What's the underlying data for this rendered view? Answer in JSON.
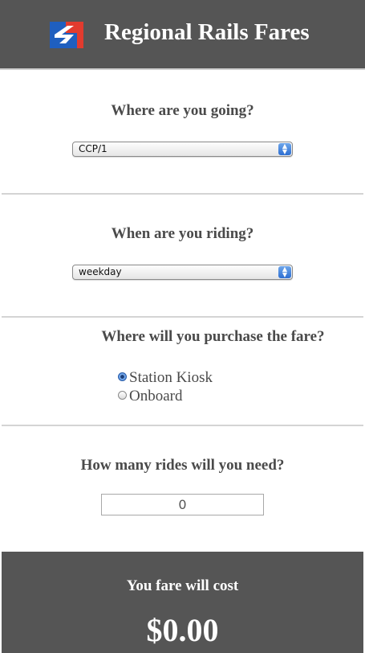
{
  "header": {
    "title": "Regional Rails Fares",
    "logo_icon": "septa-logo-icon",
    "background_color": "#555555"
  },
  "destination": {
    "question": "Where are you going?",
    "selected": "CCP/1"
  },
  "schedule": {
    "question": "When are you riding?",
    "selected": "weekday"
  },
  "purchase": {
    "question": "Where will you purchase the fare?",
    "options": [
      "Station Kiosk",
      "Onboard"
    ],
    "selected": "Station Kiosk"
  },
  "rides": {
    "question": "How many rides will you need?",
    "value": "0"
  },
  "result": {
    "label": "You fare will cost",
    "amount": "$0.00"
  },
  "colors": {
    "accent_blue": "#2e6fd2",
    "logo_red": "#e23b2e",
    "logo_blue": "#1f5fbf"
  }
}
